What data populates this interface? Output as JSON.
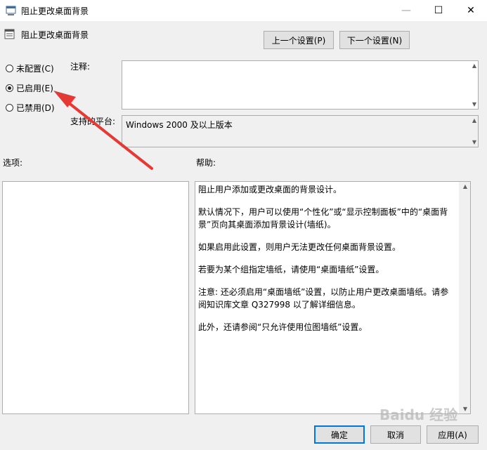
{
  "window": {
    "title": "阻止更改桌面背景",
    "minimize_glyph": "—",
    "maximize_glyph": "☐",
    "close_glyph": "✕"
  },
  "header": {
    "setting_name": "阻止更改桌面背景",
    "prev_button": "上一个设置(P)",
    "next_button": "下一个设置(N)"
  },
  "state": {
    "options": [
      {
        "label": "未配置(C)",
        "checked": false
      },
      {
        "label": "已启用(E)",
        "checked": true
      },
      {
        "label": "已禁用(D)",
        "checked": false
      }
    ]
  },
  "comment": {
    "label": "注释:",
    "value": ""
  },
  "platform": {
    "label": "支持的平台:",
    "value": "Windows 2000 及以上版本"
  },
  "options_panel": {
    "label": "选项:"
  },
  "help_panel": {
    "label": "帮助:",
    "paragraphs": [
      "阻止用户添加或更改桌面的背景设计。",
      "默认情况下，用户可以使用“个性化”或“显示控制面板”中的“桌面背景”页向其桌面添加背景设计(墙纸)。",
      "如果启用此设置，则用户无法更改任何桌面背景设置。",
      "若要为某个组指定墙纸，请使用“桌面墙纸”设置。",
      "注意: 还必须启用“桌面墙纸”设置，以防止用户更改桌面墙纸。请参阅知识库文章 Q327998 以了解详细信息。",
      "此外，还请参阅“只允许使用位图墙纸”设置。"
    ]
  },
  "footer": {
    "ok": "确定",
    "cancel": "取消",
    "apply": "应用(A)"
  },
  "annotation": {
    "arrow_color": "#e53935"
  },
  "watermark": "Baidu 经验"
}
